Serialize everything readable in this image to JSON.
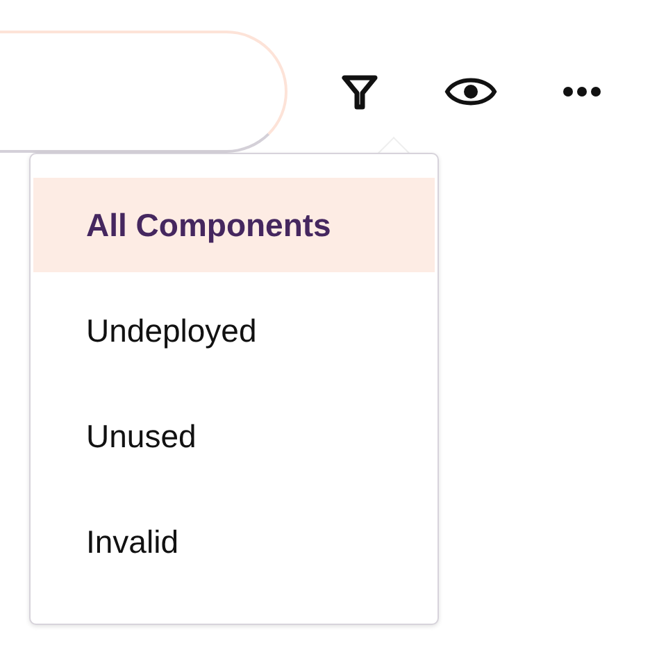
{
  "filter_menu": {
    "items": [
      {
        "label": "All Components",
        "selected": true
      },
      {
        "label": "Undeployed",
        "selected": false
      },
      {
        "label": "Unused",
        "selected": false
      },
      {
        "label": "Invalid",
        "selected": false
      }
    ]
  }
}
